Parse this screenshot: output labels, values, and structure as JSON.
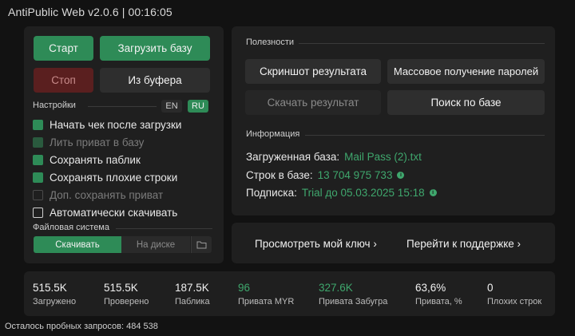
{
  "window": {
    "title": "AntiPublic Web v2.0.6 | 00:16:05"
  },
  "left": {
    "start_label": "Старт",
    "load_db_label": "Загрузить базу",
    "stop_label": "Стоп",
    "from_buffer_label": "Из буфера",
    "settings_label": "Настройки",
    "lang_en": "EN",
    "lang_ru": "RU",
    "checkboxes": [
      {
        "label": "Начать чек после загрузки",
        "checked": true,
        "enabled": true
      },
      {
        "label": "Лить приват в базу",
        "checked": true,
        "enabled": false
      },
      {
        "label": "Сохранять паблик",
        "checked": true,
        "enabled": true
      },
      {
        "label": "Сохранять плохие строки",
        "checked": true,
        "enabled": true
      },
      {
        "label": "Доп. сохранять приват",
        "checked": false,
        "enabled": false
      },
      {
        "label": "Автоматически скачивать",
        "checked": false,
        "enabled": true
      }
    ],
    "filesystem_label": "Файловая система",
    "fs_download": "Скачивать",
    "fs_on_disk": "На диске",
    "folder_icon": "folder-icon"
  },
  "utilities": {
    "section_label": "Полезности",
    "screenshot_label": "Скриншот результата",
    "bulk_passwords_label": "Массовое получение паролей",
    "download_result_label": "Скачать результат",
    "search_db_label": "Поиск по базе",
    "info_label": "Информация",
    "loaded_db_label": "Загруженная база:",
    "loaded_db_value": "Mail Pass (2).txt",
    "rows_label": "Строк в базе:",
    "rows_value": "13 704 975 733",
    "sub_label": "Подписка:",
    "sub_value": "Trial до 05.03.2025 15:18"
  },
  "links": {
    "my_key": "Просмотреть мой ключ",
    "support": "Перейти к поддержке"
  },
  "stats": [
    {
      "value": "515.5K",
      "label": "Загружено",
      "green": false
    },
    {
      "value": "515.5K",
      "label": "Проверено",
      "green": false
    },
    {
      "value": "187.5K",
      "label": "Паблика",
      "green": false
    },
    {
      "value": "96",
      "label": "Привата MYR",
      "green": true
    },
    {
      "value": "327.6K",
      "label": "Привата Забугра",
      "green": true
    },
    {
      "value": "63,6%",
      "label": "Привата, %",
      "green": false
    },
    {
      "value": "0",
      "label": "Плохих строк",
      "green": false
    }
  ],
  "footer": {
    "text": "Осталось пробных запросов: 484 538"
  },
  "colors": {
    "accent": "#2e8b57",
    "accent_text": "#3fa76d",
    "stop": "#5a1f1f",
    "background": "#121212",
    "panel": "#1f1f1f"
  }
}
